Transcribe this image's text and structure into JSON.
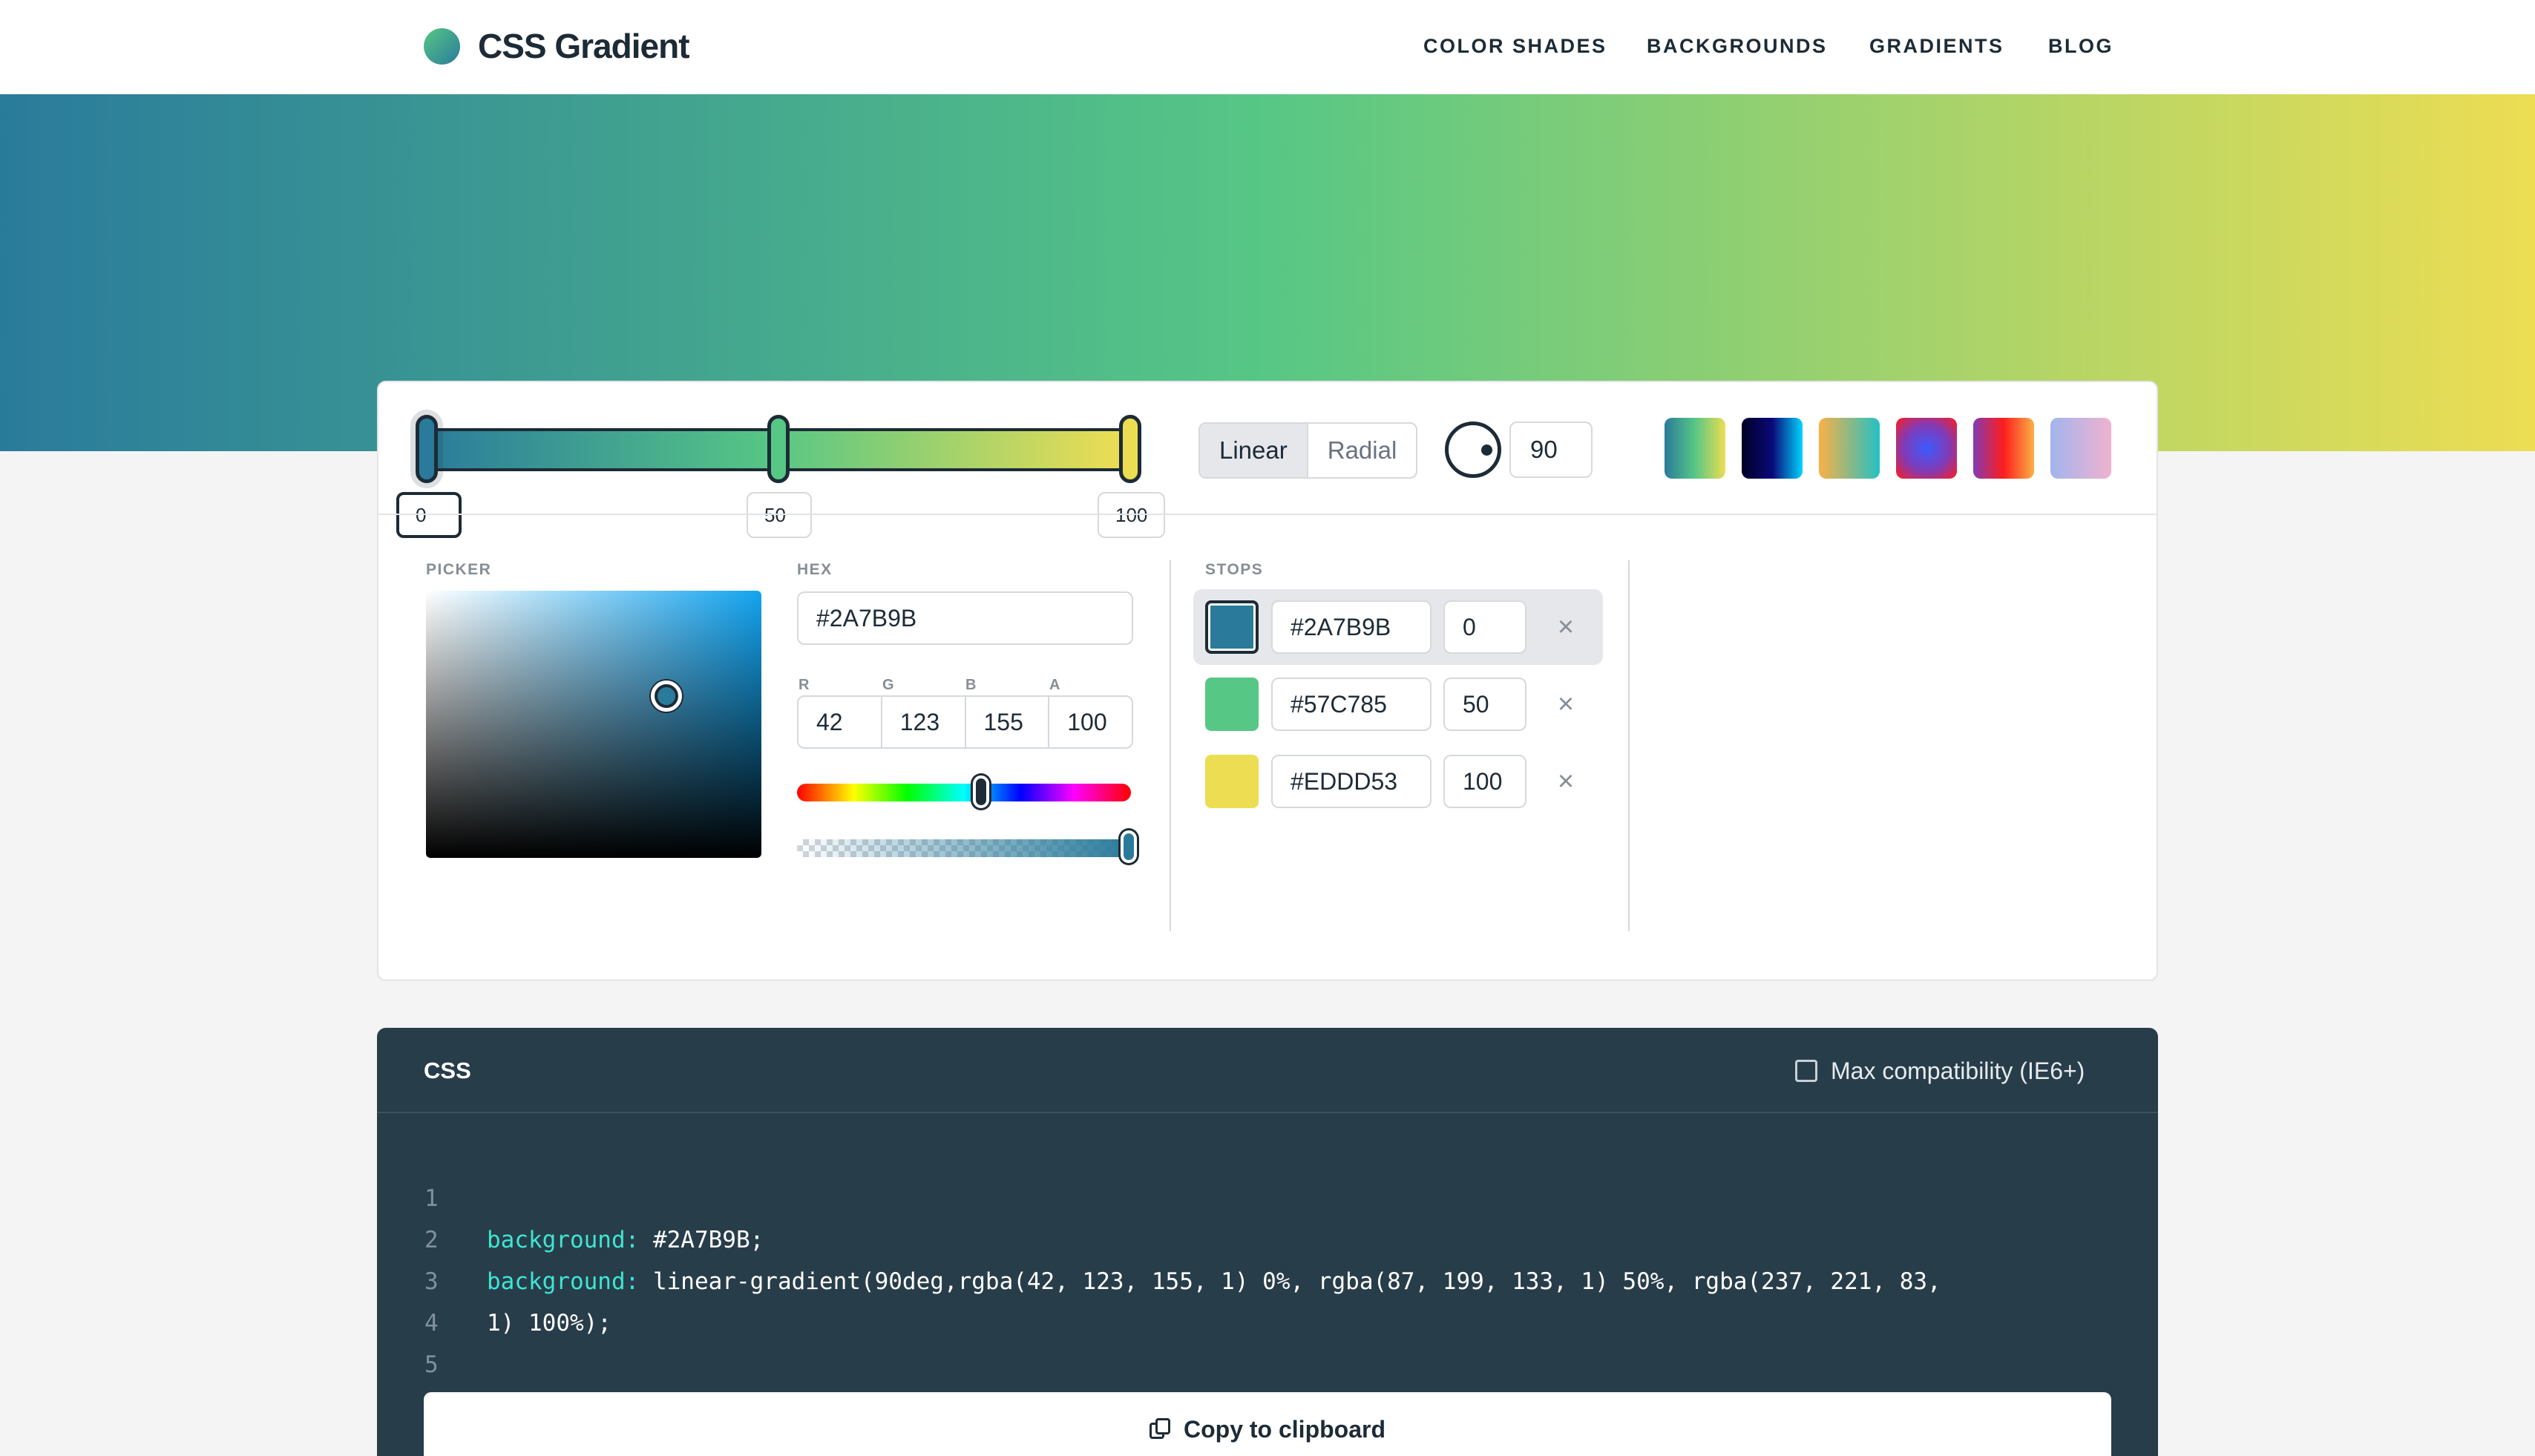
{
  "header": {
    "logo_text": "CSS Gradient",
    "nav": [
      "COLOR SHADES",
      "BACKGROUNDS",
      "GRADIENTS",
      "BLOG"
    ]
  },
  "gradient": {
    "angle": "90",
    "type_options": [
      "Linear",
      "Radial"
    ],
    "selected_type": "Linear",
    "stops": [
      {
        "hex": "#2A7B9B",
        "position": "0",
        "color": "#2a7b9b"
      },
      {
        "hex": "#57C785",
        "position": "50",
        "color": "#57c785"
      },
      {
        "hex": "#EDDD53",
        "position": "100",
        "color": "#eddd53"
      }
    ],
    "selected_stop": 0
  },
  "presets": [
    {
      "name": "preset-1",
      "colors": [
        "#2a7b9b",
        "#57c785",
        "#eddd53"
      ]
    },
    {
      "name": "preset-2",
      "colors": [
        "#020024",
        "#090979",
        "#00d4ff"
      ]
    },
    {
      "name": "preset-3",
      "colors": [
        "#fcb045",
        "#22c1c3"
      ]
    },
    {
      "name": "preset-4",
      "colors": [
        "#833ab4",
        "#3b5bff",
        "#fd1d1d"
      ]
    },
    {
      "name": "preset-5",
      "colors": [
        "#833ab4",
        "#fd1d1d",
        "#fcb045"
      ]
    },
    {
      "name": "preset-6",
      "colors": [
        "#a1b5ed",
        "#f0b2d0"
      ]
    }
  ],
  "picker": {
    "picker_label": "PICKER",
    "hex_label": "HEX",
    "hex_value": "#2A7B9B",
    "rgba_labels": [
      "R",
      "G",
      "B",
      "A"
    ],
    "rgba_values": [
      "42",
      "123",
      "155",
      "100"
    ],
    "hue_color": "#13a4f0"
  },
  "stops_panel": {
    "label": "STOPS",
    "remove_icon": "×"
  },
  "code": {
    "title": "CSS",
    "compat_label": "Max compatibility (IE6+)",
    "line_numbers": [
      "1",
      "2",
      "3",
      "4",
      "5"
    ],
    "line1_prop": "background:",
    "line1_value": " #2A7B9B;",
    "line2_prop": "background:",
    "line2_value": " linear-gradient(90deg,rgba(42, 123, 155, 1) 0%, rgba(87, 199, 133, 1) 50%, rgba(237, 221, 83,",
    "line3_value": "1) 100%);",
    "copy_label": "Copy to clipboard"
  }
}
